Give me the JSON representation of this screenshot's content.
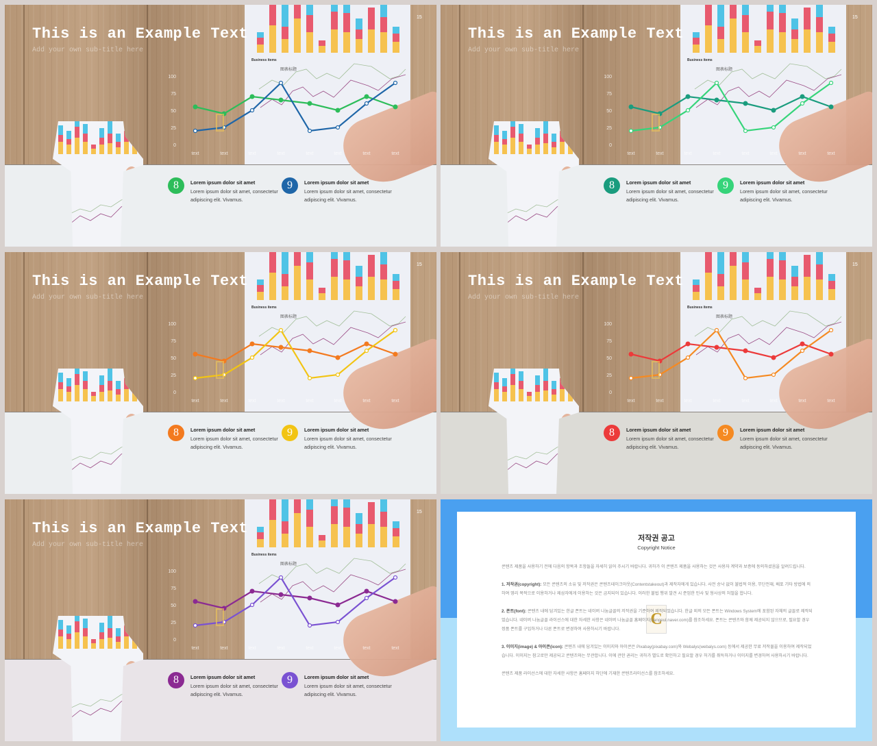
{
  "slides": [
    {
      "title": "This is an Example Text",
      "subtitle": "Add your own sub-title here",
      "page_number": "15",
      "bottom_bg": "#eceff1",
      "colors": [
        "#2dbd5a",
        "#1f66a8"
      ],
      "items": [
        {
          "number": "8",
          "heading": "Lorem ipsum dolor sit amet",
          "body": "Lorem ipsum dolor sit amet, consectetur adipiscing elit. Vivamus."
        },
        {
          "number": "9",
          "heading": "Lorem ipsum dolor sit amet",
          "body": "Lorem ipsum dolor sit amet, consectetur adipiscing elit. Vivamus."
        }
      ]
    },
    {
      "title": "This is an Example Text",
      "subtitle": "Add your own sub-title here",
      "page_number": "15",
      "bottom_bg": "#eceff1",
      "colors": [
        "#1a9c7e",
        "#36d47a"
      ],
      "items": [
        {
          "number": "8",
          "heading": "Lorem ipsum dolor sit amet",
          "body": "Lorem ipsum dolor sit amet, consectetur adipiscing elit. Vivamus."
        },
        {
          "number": "9",
          "heading": "Lorem ipsum dolor sit amet",
          "body": "Lorem ipsum dolor sit amet, consectetur adipiscing elit. Vivamus."
        }
      ]
    },
    {
      "title": "This is an Example Text",
      "subtitle": "Add your own sub-title here",
      "page_number": "15",
      "bottom_bg": "#eceff1",
      "colors": [
        "#f37a1f",
        "#f2c414"
      ],
      "items": [
        {
          "number": "8",
          "heading": "Lorem ipsum dolor sit amet",
          "body": "Lorem ipsum dolor sit amet, consectetur adipiscing elit. Vivamus."
        },
        {
          "number": "9",
          "heading": "Lorem ipsum dolor sit amet",
          "body": "Lorem ipsum dolor sit amet, consectetur adipiscing elit. Vivamus."
        }
      ]
    },
    {
      "title": "This is an Example Text",
      "subtitle": "Add your own sub-title here",
      "page_number": "15",
      "bottom_bg": "#dcdbd6",
      "colors": [
        "#ec3a3a",
        "#f58a22"
      ],
      "items": [
        {
          "number": "8",
          "heading": "Lorem ipsum dolor sit amet",
          "body": "Lorem ipsum dolor sit amet, consectetur adipiscing elit. Vivamus."
        },
        {
          "number": "9",
          "heading": "Lorem ipsum dolor sit amet",
          "body": "Lorem ipsum dolor sit amet, consectetur adipiscing elit. Vivamus."
        }
      ]
    },
    {
      "title": "This is an Example Text",
      "subtitle": "Add your own sub-title here",
      "page_number": "15",
      "bottom_bg": "#e9e4e8",
      "colors": [
        "#8b2a92",
        "#7a52d2"
      ],
      "items": [
        {
          "number": "8",
          "heading": "Lorem ipsum dolor sit amet",
          "body": "Lorem ipsum dolor sit amet, consectetur adipiscing elit. Vivamus."
        },
        {
          "number": "9",
          "heading": "Lorem ipsum dolor sit amet",
          "body": "Lorem ipsum dolor sit amet, consectetur adipiscing elit. Vivamus."
        }
      ]
    }
  ],
  "chart_data": {
    "type": "line",
    "categories": [
      "text",
      "text",
      "text",
      "text",
      "text",
      "text",
      "text",
      "text"
    ],
    "yticks": [
      "0",
      "25",
      "50",
      "75",
      "100"
    ],
    "ylim": [
      0,
      100
    ],
    "series": [
      {
        "values": [
          55,
          45,
          70,
          65,
          60,
          50,
          70,
          55
        ]
      },
      {
        "values": [
          20,
          25,
          50,
          90,
          20,
          25,
          60,
          90
        ]
      }
    ],
    "photo_labels": {
      "business_items": "Business items",
      "chart_title": "图表标题"
    }
  },
  "copyright": {
    "title": "저작권 공고",
    "subtitle": "Copyright Notice",
    "intro": "콘텐츠 제품을 사용하기 전에 다음의 항목과 조항들을 자세히 읽어 주시기 바랍니다. 귀하가 이 콘텐츠 제품을 사용하는 것은 사용자 계약과 보증에 동의하셨음을 알려드립니다.",
    "sections": [
      {
        "label": "1. 저작권(copyright):",
        "text": "모든 콘텐츠의 소유 및 저작권은 콘텐츠테이크아웃(Contentstakeout)과 제작자에게 있습니다. 사전 승낙 없이 불법적 이용, 무단전재, 배포 기타 방법에 의하여 영리 목적으로 이용하거나 제삼자에게 이용하는 것은 금지되어 있습니다. 이러한 불법 행위 발견 시 준엄한 민사 및 형사상의 처벌을 합니다."
      },
      {
        "label": "2. 폰트(font):",
        "text": "콘텐츠 내에 담겨있는 한글 폰트는 네이버 나눔글꼴의 저작권을 기준하여 제작되었습니다. 한글 외의 모든 폰트는 Windows System에 포함된 자체의 글꼴로 제작되었습니다. 네이버 나눔글꼴 라이선스에 대한 자세한 사항은 네이버 나눔글꼴 홈페이지(hangeul.naver.com)를 참조하세요. 폰트는 콘텐츠와 함께 제공되지 않으므로, 필요할 경우 정품 폰트를 구입하거나 다른 폰트로 변경하여 사용하시기 바랍니다."
      },
      {
        "label": "3. 이미지(image) & 아이콘(icon):",
        "text": "콘텐츠 내에 담겨있는 이미지와 아이콘은 Pixabay(pixabay.com)와 Webalys(webalys.com) 등에서 제공한 무료 저작물을 이용하여 제작되었습니다. 이미지는 참고로만 제공되고 콘텐츠와는 무관합니다. 이에 관한 권리는 귀하가 별도로 확인하고 필요할 경우 허가를 취득하거나 이미지를 변경하여 사용하시기 바랍니다."
      }
    ],
    "footer": "콘텐츠 제품 라이선스에 대한 자세한 사항은 홈페이지 하단에 기재한 콘텐츠라이선스를 참조하세요.",
    "logo": "C",
    "colors": {
      "top": "#4aa0f0",
      "bottom": "#aee0fb"
    }
  }
}
